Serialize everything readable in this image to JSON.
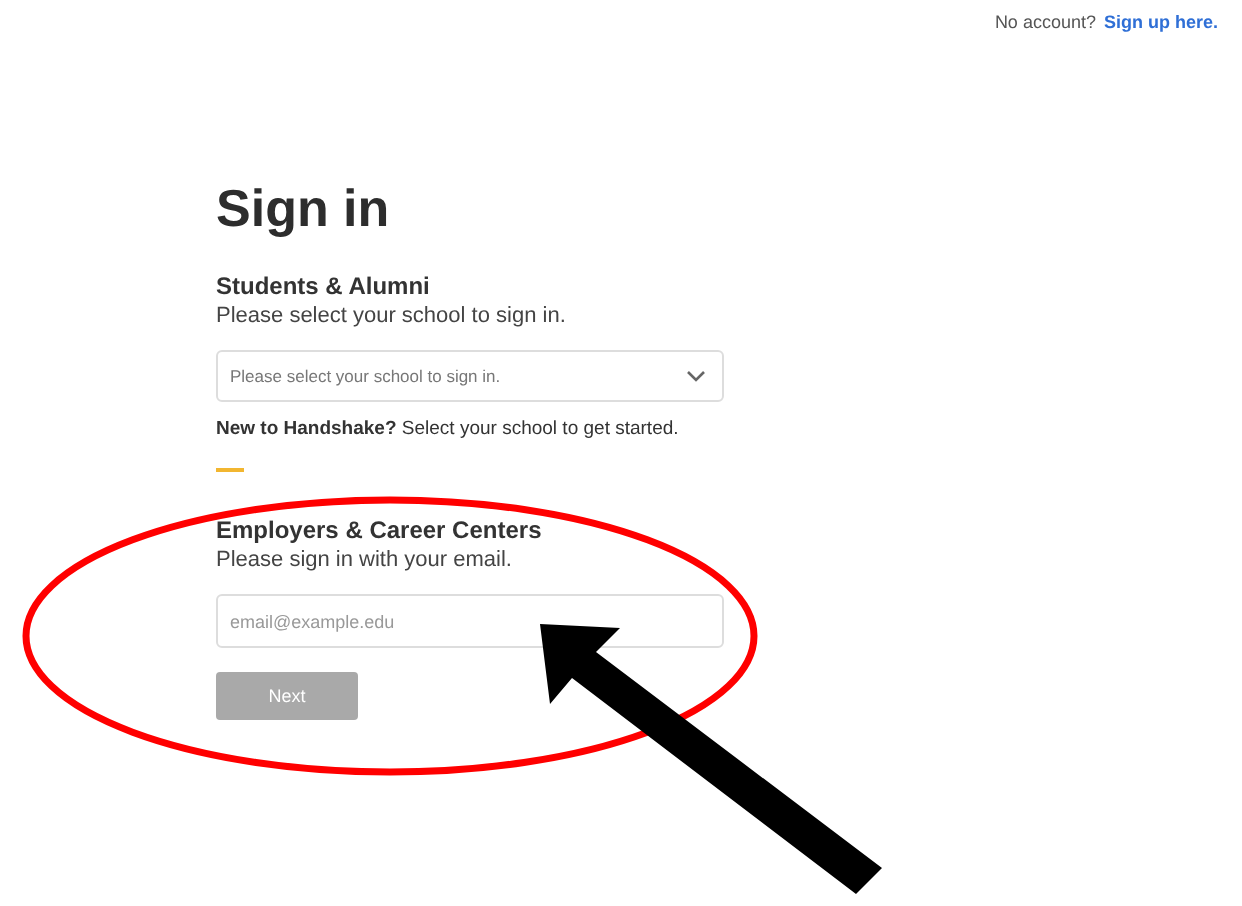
{
  "header": {
    "prompt": "No account?",
    "link": "Sign up here."
  },
  "title": "Sign in",
  "students": {
    "heading": "Students & Alumni",
    "subtitle": "Please select your school to sign in.",
    "select": {
      "placeholder": "Please select your school to sign in."
    },
    "note_bold": "New to Handshake?",
    "note": "Select your school to get started."
  },
  "employers": {
    "heading": "Employers & Career Centers",
    "subtitle": "Please sign in with your email.",
    "email": {
      "placeholder": "email@example.edu"
    },
    "button": {
      "label": "Next",
      "disabled": true
    }
  },
  "annotations": [
    {
      "kind": "ellipse"
    },
    {
      "kind": "arrow"
    }
  ]
}
